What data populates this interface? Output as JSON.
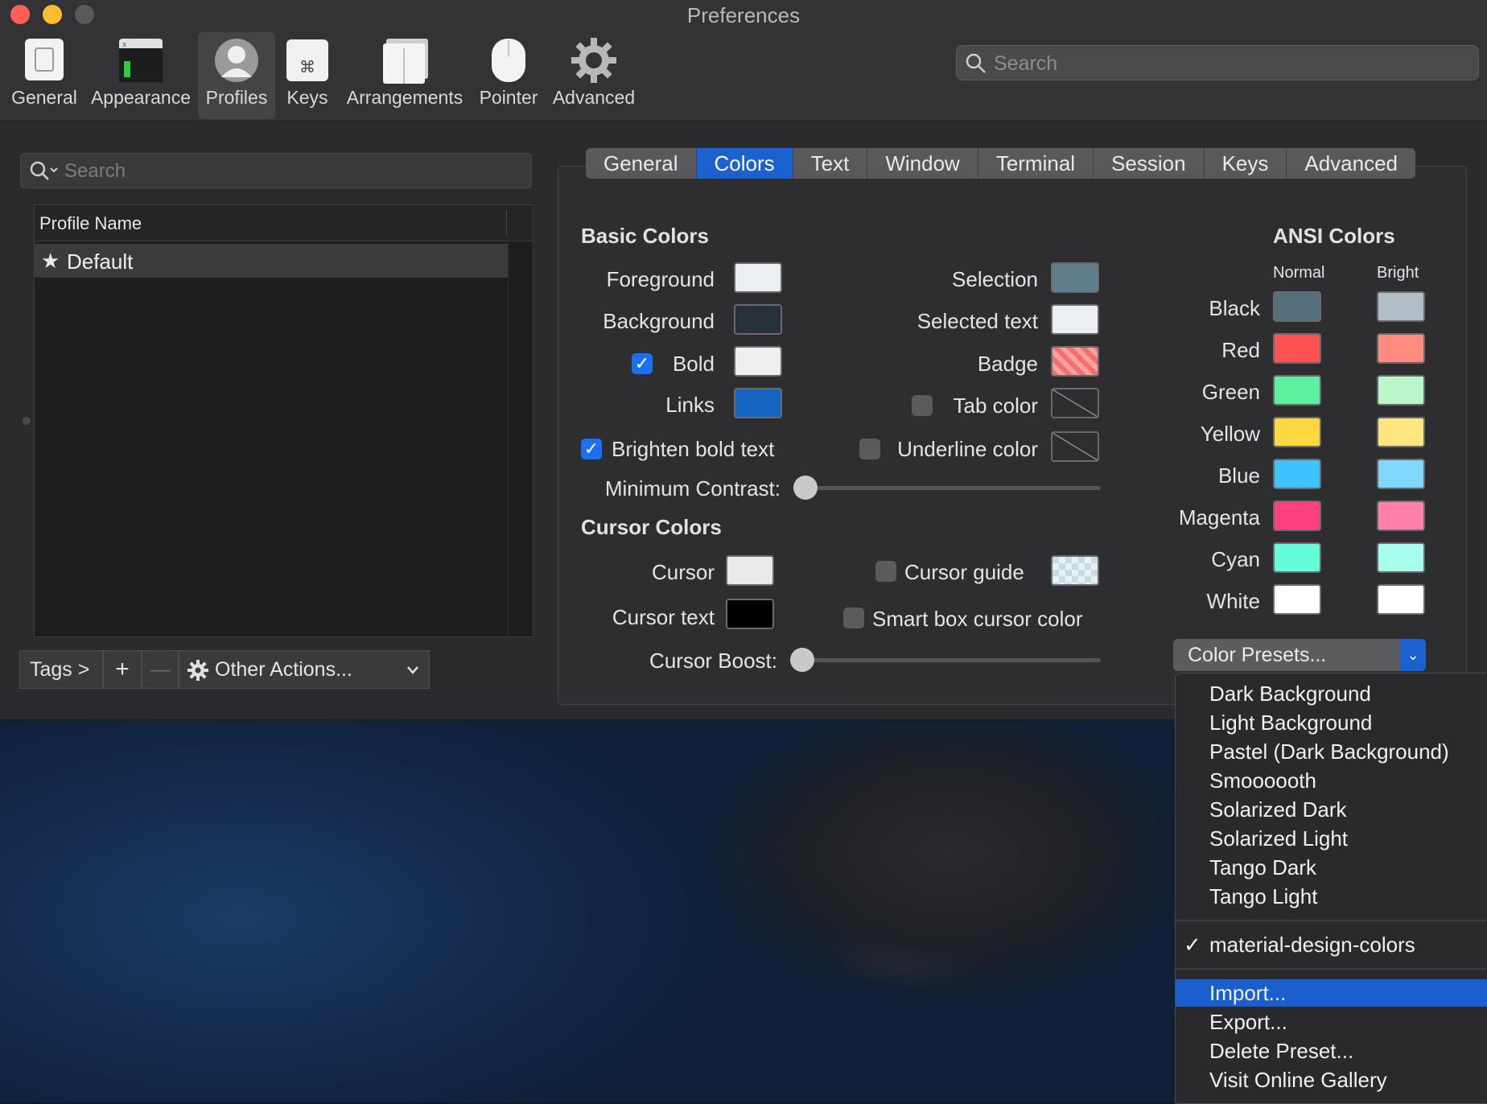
{
  "window": {
    "title": "Preferences"
  },
  "toolbar": {
    "items": [
      {
        "label": "General",
        "icon": "general-icon"
      },
      {
        "label": "Appearance",
        "icon": "appearance-icon"
      },
      {
        "label": "Profiles",
        "icon": "profiles-icon",
        "selected": true
      },
      {
        "label": "Keys",
        "icon": "keys-icon"
      },
      {
        "label": "Arrangements",
        "icon": "arrangements-icon"
      },
      {
        "label": "Pointer",
        "icon": "pointer-icon"
      },
      {
        "label": "Advanced",
        "icon": "gear-icon"
      }
    ],
    "search_placeholder": "Search"
  },
  "profiles": {
    "search_placeholder": "Search",
    "column_header": "Profile Name",
    "rows": [
      {
        "name": "Default",
        "default": true
      }
    ],
    "tags_label": "Tags >",
    "add_label": "+",
    "remove_label": "—",
    "other_actions_label": "Other Actions..."
  },
  "tabs": [
    "General",
    "Colors",
    "Text",
    "Window",
    "Terminal",
    "Session",
    "Keys",
    "Advanced"
  ],
  "active_tab": "Colors",
  "basic_colors": {
    "title": "Basic Colors",
    "foreground": {
      "label": "Foreground",
      "color": "#eceff1"
    },
    "background": {
      "label": "Background",
      "color": "#263238"
    },
    "bold": {
      "label": "Bold",
      "color": "#eeeeee",
      "checked": true
    },
    "links": {
      "label": "Links",
      "color": "#1565c0"
    },
    "selection": {
      "label": "Selection",
      "color": "#607d8b"
    },
    "selected_text": {
      "label": "Selected text",
      "color": "#eceff1"
    },
    "badge": {
      "label": "Badge",
      "color": "#f07070"
    },
    "tab_color": {
      "label": "Tab color",
      "checked": false
    },
    "underline_color": {
      "label": "Underline color",
      "checked": false
    },
    "brighten_bold": {
      "label": "Brighten bold text",
      "checked": true
    },
    "min_contrast": {
      "label": "Minimum Contrast:",
      "value": 0
    }
  },
  "cursor_colors": {
    "title": "Cursor Colors",
    "cursor": {
      "label": "Cursor",
      "color": "#eaeaea"
    },
    "cursor_text": {
      "label": "Cursor text",
      "color": "#000000"
    },
    "cursor_guide": {
      "label": "Cursor guide",
      "checked": false
    },
    "smart_box": {
      "label": "Smart box cursor color",
      "checked": false
    },
    "cursor_boost": {
      "label": "Cursor Boost:",
      "value": 0
    }
  },
  "ansi": {
    "title": "ANSI Colors",
    "normal_label": "Normal",
    "bright_label": "Bright",
    "rows": [
      {
        "name": "Black",
        "normal": "#546e7a",
        "bright": "#b0bec5"
      },
      {
        "name": "Red",
        "normal": "#ff5252",
        "bright": "#ff8a80"
      },
      {
        "name": "Green",
        "normal": "#5cf19e",
        "bright": "#b9f6ca"
      },
      {
        "name": "Yellow",
        "normal": "#ffd740",
        "bright": "#ffe57f"
      },
      {
        "name": "Blue",
        "normal": "#40c4ff",
        "bright": "#80d8ff"
      },
      {
        "name": "Magenta",
        "normal": "#ff4081",
        "bright": "#ff80ab"
      },
      {
        "name": "Cyan",
        "normal": "#64fcda",
        "bright": "#a7fdeb"
      },
      {
        "name": "White",
        "normal": "#ffffff",
        "bright": "#ffffff"
      }
    ]
  },
  "presets": {
    "button_label": "Color Presets...",
    "menu_group1": [
      "Dark Background",
      "Light Background",
      "Pastel (Dark Background)",
      "Smoooooth",
      "Solarized Dark",
      "Solarized Light",
      "Tango Dark",
      "Tango Light"
    ],
    "menu_group2": [
      {
        "label": "material-design-colors",
        "checked": true
      }
    ],
    "menu_group3": [
      "Import...",
      "Export...",
      "Delete Preset...",
      "Visit Online Gallery"
    ],
    "highlighted": "Import..."
  }
}
